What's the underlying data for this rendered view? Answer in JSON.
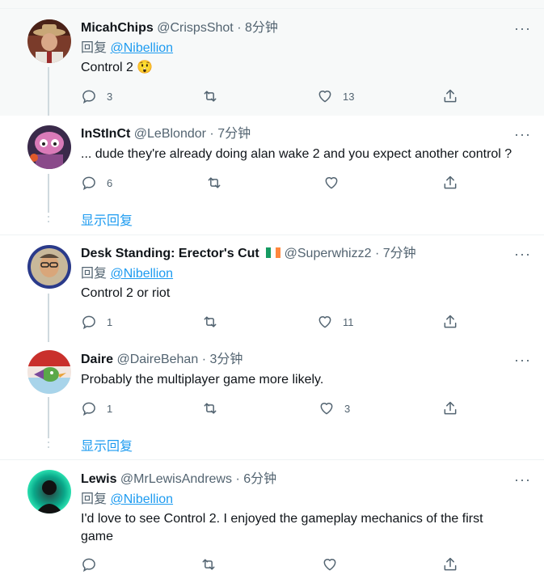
{
  "tweets": [
    {
      "name": "MicahChips",
      "handle": "@CrispsShot",
      "dot": "·",
      "time": "8分钟",
      "reply_prefix": "回复",
      "reply_mention": "@Nibellion",
      "text": "Control 2 😲",
      "replies": "3",
      "retweets": "",
      "likes": "13"
    },
    {
      "name": "InStInCt",
      "handle": "@LeBlondor",
      "dot": "·",
      "time": "7分钟",
      "text": "... dude they're already doing alan wake 2 and you expect another control ?",
      "replies": "6",
      "retweets": "",
      "likes": ""
    },
    {
      "name": "Desk Standing: Erector's Cut",
      "handle": "@Superwhizz2",
      "dot": "·",
      "time": "7分钟",
      "reply_prefix": "回复",
      "reply_mention": "@Nibellion",
      "text": "Control 2 or riot",
      "replies": "1",
      "retweets": "",
      "likes": "11"
    },
    {
      "name": "Daire",
      "handle": "@DaireBehan",
      "dot": "·",
      "time": "3分钟",
      "text": "Probably the multiplayer game more likely.",
      "replies": "1",
      "retweets": "",
      "likes": "3"
    },
    {
      "name": "Lewis",
      "handle": "@MrLewisAndrews",
      "dot": "·",
      "time": "6分钟",
      "reply_prefix": "回复",
      "reply_mention": "@Nibellion",
      "text": "I'd love to see Control 2. I enjoyed the gameplay mechanics of the first game",
      "replies": "",
      "retweets": "",
      "likes": ""
    }
  ],
  "show_replies_label": "显示回复",
  "more_label": "···",
  "colors": {
    "accent": "#1d9bf0",
    "secondary_text": "#536471",
    "highlight_bg": "#f7f9f9",
    "divider": "#eff3f4"
  },
  "icons": [
    "reply-icon",
    "retweet-icon",
    "like-icon",
    "share-icon",
    "more-icon",
    "ireland-flag-icon"
  ]
}
